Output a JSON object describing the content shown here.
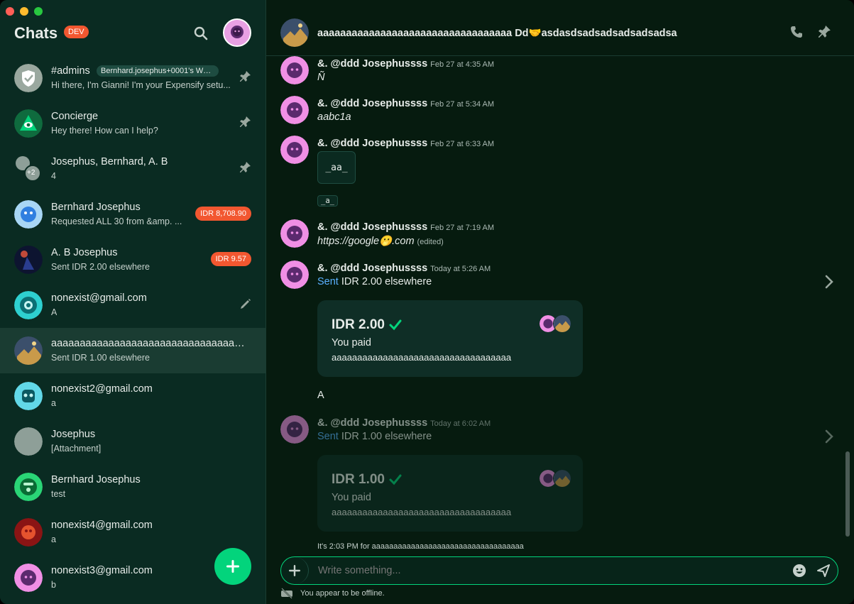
{
  "window": {
    "title": "Chats"
  },
  "sidebar": {
    "title": "Chats",
    "env_badge": "DEV",
    "chats": [
      {
        "name": "#admins",
        "chip": "Bernhard.josephus+0001's Work...",
        "preview": "Hi there, I'm Gianni! I'm your Expensify setu...",
        "pinned": true
      },
      {
        "name": "Concierge",
        "preview": "Hey there! How can I help?",
        "pinned": true
      },
      {
        "name": "Josephus, Bernhard, A. B",
        "preview": "4",
        "pinned": true,
        "extra": "+2"
      },
      {
        "name": "Bernhard Josephus",
        "preview": "Requested ALL 30 from &amp. ...",
        "badge": "IDR 8,708.90"
      },
      {
        "name": "A. B Josephus",
        "preview": "Sent IDR 2.00 elsewhere",
        "badge": "IDR 9.57"
      },
      {
        "name": "nonexist@gmail.com",
        "preview": "A",
        "draft": true
      },
      {
        "name": "aaaaaaaaaaaaaaaaaaaaaaaaaaaaaaaaaaa...",
        "preview": "Sent IDR 1.00 elsewhere",
        "active": true
      },
      {
        "name": "nonexist2@gmail.com",
        "preview": "a"
      },
      {
        "name": "Josephus",
        "preview": "[Attachment]"
      },
      {
        "name": "Bernhard Josephus",
        "preview": "test"
      },
      {
        "name": "nonexist4@gmail.com",
        "preview": "a"
      },
      {
        "name": "nonexist3@gmail.com",
        "preview": "b"
      }
    ]
  },
  "header": {
    "title": "aaaaaaaaaaaaaaaaaaaaaaaaaaaaaaaaaa Dd🤝asdasdsadsadsadsadsadsa"
  },
  "messages": [
    {
      "author": "&. @ddd Josephussss",
      "time": "Feb 27 at 4:35 AM",
      "text": "Ñ"
    },
    {
      "author": "&. @ddd Josephussss",
      "time": "Feb 27 at 5:34 AM",
      "text": "aabc1a"
    },
    {
      "author": "&. @ddd Josephussss",
      "time": "Feb 27 at 6:33 AM",
      "code_block": "_aa_",
      "inline_code": "_a_"
    },
    {
      "author": "&. @ddd Josephussss",
      "time": "Feb 27 at 7:19 AM",
      "text": "https://google🫢.com",
      "edited": "(edited)"
    },
    {
      "author": "&. @ddd Josephussss",
      "time": "Today at 5:26 AM",
      "sent_word": "Sent",
      "text": "IDR 2.00 elsewhere",
      "card": {
        "amount": "IDR 2.00",
        "label": "You paid",
        "recipient": "aaaaaaaaaaaaaaaaaaaaaaaaaaaaaaaaaaa"
      }
    },
    {
      "text": "A"
    },
    {
      "author": "&. @ddd Josephussss",
      "time": "Today at 6:02 AM",
      "sent_word": "Sent",
      "text": "IDR 1.00 elsewhere",
      "card": {
        "amount": "IDR 1.00",
        "label": "You paid",
        "recipient": "aaaaaaaaaaaaaaaaaaaaaaaaaaaaaaaaaaa"
      }
    }
  ],
  "local_time_note": "It's 2:03 PM for aaaaaaaaaaaaaaaaaaaaaaaaaaaaaaaaaaa",
  "composer": {
    "placeholder": "Write something..."
  },
  "status": {
    "offline": "You appear to be offline."
  },
  "colors": {
    "accent": "#03d47c",
    "danger_badge": "#f25730",
    "link": "#5ab0ff",
    "background": "#061b0f",
    "sidebar": "#0a2b22"
  },
  "icons": [
    "search-icon",
    "plus-icon",
    "pin-icon",
    "pencil-icon",
    "phone-icon",
    "chevron-right-icon",
    "checkmark-icon",
    "emoji-icon",
    "send-icon",
    "offline-icon"
  ]
}
